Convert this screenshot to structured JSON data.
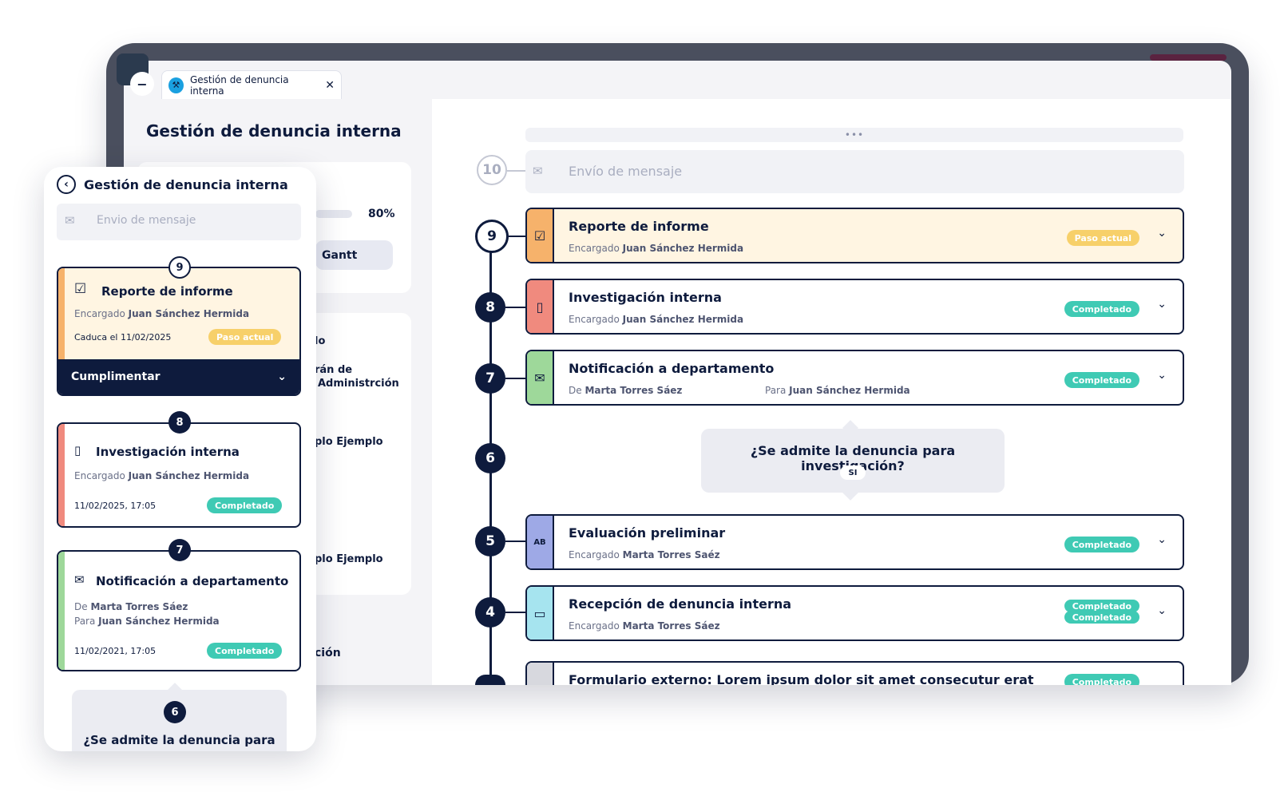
{
  "colors": {
    "navy": "#0e1b3d",
    "current": "#f7d06a",
    "completed": "#3fcab4",
    "stripe_orange": "#f6b26b",
    "stripe_red": "#f08a7e",
    "stripe_green": "#9ed89a",
    "stripe_blue": "#9ea9e6",
    "stripe_cyan": "#a6e4ef",
    "stripe_gray": "#d7d8de",
    "current_bg": "#fff5e2"
  },
  "tab": {
    "label": "Gestión de denuncia interna",
    "minus": "−",
    "close": "✕"
  },
  "page": {
    "title": "Gestión de denuncia interna"
  },
  "left": {
    "progress_percent": 80,
    "progress_label": "80%",
    "gantt_label": "Gantt",
    "snippets": [
      "lo",
      "rán de",
      "Administrción",
      "plo Ejemplo",
      "plo Ejemplo",
      "ción"
    ]
  },
  "main": {
    "more": "•••",
    "step10": {
      "num": "10",
      "title": "Envío de mensaje"
    },
    "steps": [
      {
        "num": "9",
        "title": "Reporte de informe",
        "sub_label": "Encargado",
        "sub_name": "Juan Sánchez Hermida",
        "badge": "Paso actual",
        "icon": "checkbox-icon"
      },
      {
        "num": "8",
        "title": "Investigación interna",
        "sub_label": "Encargado",
        "sub_name": "Juan Sánchez Hermida",
        "badge": "Completado",
        "icon": "traffic-light-icon"
      },
      {
        "num": "7",
        "title": "Notificación a departamento",
        "sub_label": "De",
        "sub_name": "Marta Torres Sáez",
        "sub2_label": "Para",
        "sub2_name": "Juan Sánchez Hermida",
        "badge": "Completado",
        "icon": "envelope-icon"
      },
      {
        "num": "5",
        "title": "Evaluación preliminar",
        "sub_label": "Encargado",
        "sub_name": "Marta Torres Saéz",
        "badge": "Completado",
        "icon": "ab-card-icon"
      },
      {
        "num": "4",
        "title": "Recepción de denuncia interna",
        "sub_label": "Encargado",
        "sub_name": "Marta Torres Sáez",
        "badge": "Completado",
        "badge2": "Completado",
        "icon": "ticket-icon"
      },
      {
        "title": "Formulario externo: Lorem ipsum dolor sit amet consecutur erat",
        "badge": "Completado"
      }
    ],
    "question": {
      "num": "6",
      "text": "¿Se admite la denuncia para investigación?",
      "answer": "SI"
    }
  },
  "phone": {
    "back_title": "Gestión de denuncia interna",
    "msg_placeholder": "Envio de mensaje",
    "card9": {
      "num": "9",
      "title": "Reporte de informe",
      "sub_label": "Encargado",
      "sub_name": "Juan Sánchez Hermida",
      "date": "Caduca el 11/02/2025",
      "badge": "Paso actual",
      "action": "Cumplimentar"
    },
    "card8": {
      "num": "8",
      "title": "Investigación interna",
      "sub_label": "Encargado",
      "sub_name": "Juan Sánchez Hermida",
      "date": "11/02/2025, 17:05",
      "badge": "Completado"
    },
    "card7": {
      "num": "7",
      "title": "Notificación a departamento",
      "sub_label": "De",
      "sub_name": "Marta Torres Sáez",
      "sub2_label": "Para",
      "sub2_name": "Juan Sánchez Hermida",
      "date": "11/02/2021, 17:05",
      "badge": "Completado"
    },
    "q": {
      "num": "6",
      "text": "¿Se admite la denuncia para"
    }
  }
}
